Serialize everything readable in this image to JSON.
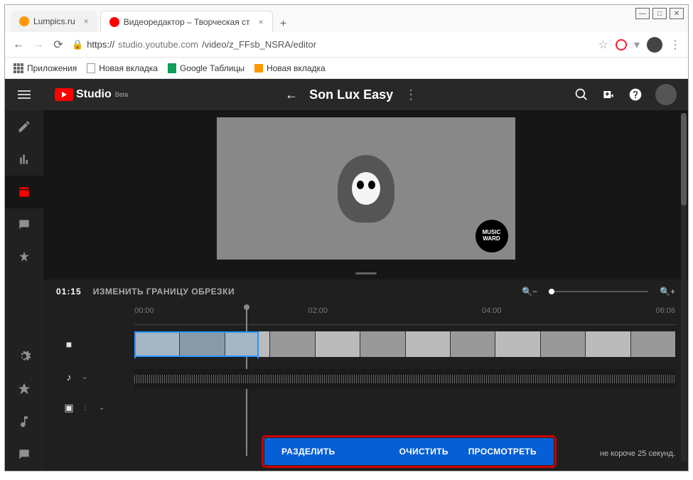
{
  "window_controls": {
    "min": "—",
    "max": "□",
    "close": "✕"
  },
  "tabs": {
    "inactive": {
      "title": "Lumpics.ru",
      "close": "×",
      "favicon_color": "#ff9800"
    },
    "active": {
      "title": "Видеоредактор – Творческая ст",
      "close": "×",
      "favicon_color": "#ff0000"
    }
  },
  "address": {
    "protocol": "https://",
    "host": "studio.youtube.com",
    "path": "/video/z_FFsb_NSRA/editor"
  },
  "bookmarks": {
    "apps": "Приложения",
    "items": [
      "Новая вкладка",
      "Google Таблицы",
      "Новая вкладка"
    ]
  },
  "studio": {
    "brand": "Studio",
    "beta": "Beta",
    "video_title": "Son Lux Easy"
  },
  "badge": "MUSIC\nWARD",
  "timeline": {
    "position": "01:15",
    "trim_label": "ИЗМЕНИТЬ ГРАНИЦУ ОБРЕЗКИ",
    "ticks": [
      "00:00",
      "02:00",
      "04:00",
      "06:06"
    ]
  },
  "bottombar": {
    "split": "РАЗДЕЛИТЬ",
    "clear": "ОЧИСТИТЬ",
    "preview": "ПРОСМОТРЕТЬ"
  },
  "hint_suffix": "не короче 25 секунд."
}
